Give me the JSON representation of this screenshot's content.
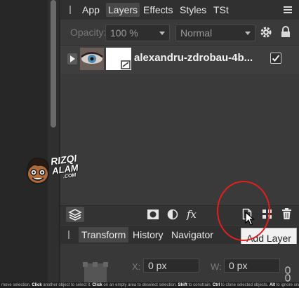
{
  "tabs": [
    {
      "label": "App",
      "active": false
    },
    {
      "label": "Layers",
      "active": true
    },
    {
      "label": "Effects",
      "active": false
    },
    {
      "label": "Styles",
      "active": false
    },
    {
      "label": "TSt",
      "active": false
    }
  ],
  "options": {
    "opacity_label": "Opacity:",
    "opacity_value": "100 %",
    "blend_mode": "Normal"
  },
  "layer": {
    "name": "alexandru-zdrobau-4b...",
    "visible": true
  },
  "tooltip": "Add Layer",
  "bottom_tabs": [
    {
      "label": "Transform",
      "active": true
    },
    {
      "label": "History",
      "active": false
    },
    {
      "label": "Navigator",
      "active": false
    }
  ],
  "transform": {
    "x_label": "X:",
    "x_value": "0 px",
    "w_label": "W:",
    "w_value": "0 px"
  },
  "watermark": {
    "line1": "RIZQI",
    "line2": "ALAM",
    "line3": ".COM"
  },
  "status": {
    "parts": [
      {
        "t": "move selection. ",
        "b": false
      },
      {
        "t": "Click",
        "b": true
      },
      {
        "t": " another object to select it. ",
        "b": false
      },
      {
        "t": "Click",
        "b": true
      },
      {
        "t": " on an empty area to deselect selection. ",
        "b": false
      },
      {
        "t": "Shift",
        "b": true
      },
      {
        "t": " to constrain. ",
        "b": false
      },
      {
        "t": "Ctrl",
        "b": true
      },
      {
        "t": " to clone selected objects. ",
        "b": false
      },
      {
        "t": "Alt",
        "b": true
      },
      {
        "t": " to ignore snap",
        "b": false
      }
    ]
  },
  "colors": {
    "annotation_ring": "#e0201e",
    "panel": "#3a3a3a"
  }
}
